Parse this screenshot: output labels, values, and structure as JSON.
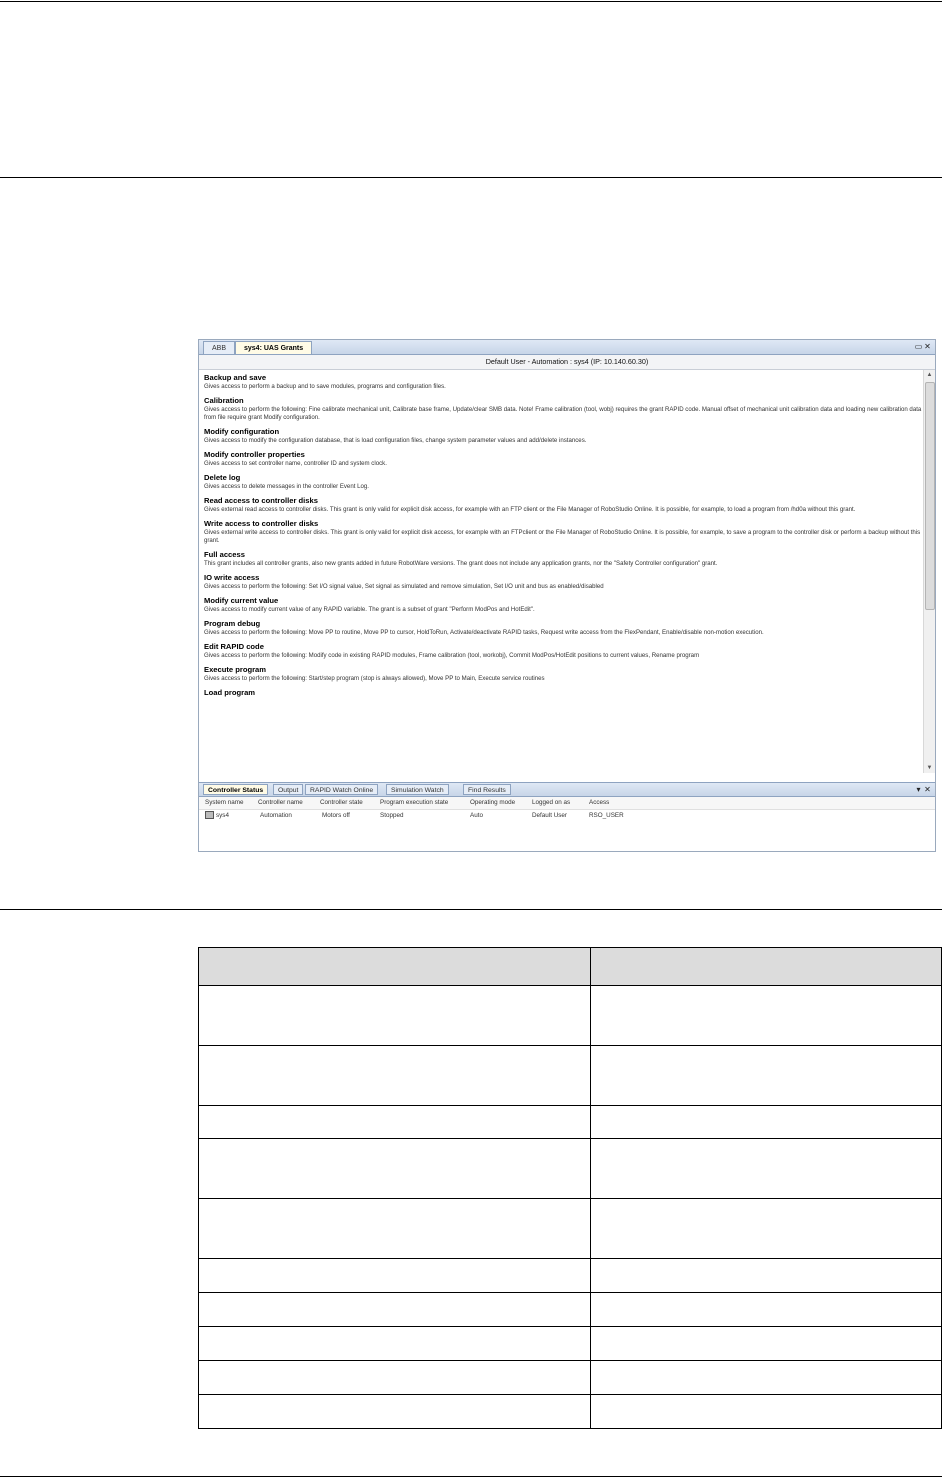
{
  "window": {
    "doc_tabs": [
      "ABB",
      "sys4: UAS Grants"
    ],
    "header": "Default User - Automation : sys4     (IP: 10.140.60.30)",
    "grants": [
      {
        "name": "Backup and save",
        "desc": "Gives access to perform a backup and to save modules, programs and configuration files."
      },
      {
        "name": "Calibration",
        "desc": "Gives access to perform the following: Fine calibrate mechanical unit, Calibrate base frame, Update/clear SMB data. Note! Frame calibration (tool, wobj) requires the grant RAPID code. Manual offset of mechanical unit calibration data and loading new calibration data from file require grant Modify configuration."
      },
      {
        "name": "Modify configuration",
        "desc": "Gives access to modify the configuration database, that is load configuration files, change system parameter values and add/delete instances."
      },
      {
        "name": "Modify controller properties",
        "desc": "Gives access to set controller name, controller ID and system clock."
      },
      {
        "name": "Delete log",
        "desc": "Gives access to delete messages in the controller Event Log."
      },
      {
        "name": "Read access to controller disks",
        "desc": "Gives external read access to controller disks. This grant is only valid for explicit disk access, for example with an FTP client or the File Manager of RoboStudio Online. It is possible, for example, to load a program from /hd0a without this grant."
      },
      {
        "name": "Write access to controller disks",
        "desc": "Gives external write access to controller disks. This grant is only valid for explicit disk access, for example with an FTPclient or the File Manager of RoboStudio Online. It is possible, for example, to save a program to the controller disk or perform a backup without this grant."
      },
      {
        "name": "Full access",
        "desc": "This grant includes all controller grants, also new grants added in future RobotWare versions. The grant does not include any application grants, nor the \"Safety Controller configuration\" grant."
      },
      {
        "name": "IO write access",
        "desc": "Gives access to perform the following: Set I/O signal value, Set signal as simulated and remove simulation, Set I/O unit and bus as enabled/disabled"
      },
      {
        "name": "Modify current value",
        "desc": "Gives access to modify current value of any RAPID variable. The grant is a subset of grant \"Perform ModPos and HotEdit\"."
      },
      {
        "name": "Program debug",
        "desc": "Gives access to perform the following: Move PP to routine, Move PP to cursor, HoldToRun, Activate/deactivate RAPID tasks, Request write access from the FlexPendant, Enable/disable non-motion execution."
      },
      {
        "name": "Edit RAPID code",
        "desc": "Gives access to perform the following: Modify code in existing RAPID modules, Frame calibration (tool, workobj), Commit ModPos/HotEdit positions to current values, Rename program"
      },
      {
        "name": "Execute program",
        "desc": "Gives access to perform the following: Start/step program (stop is always allowed), Move PP to Main, Execute service routines"
      },
      {
        "name": "Load program",
        "desc": ""
      }
    ],
    "bottom_tabs": [
      "Controller Status",
      "Output",
      "RAPID Watch Online",
      "Simulation Watch",
      "Find Results"
    ],
    "status_columns": [
      "System name",
      "Controller name",
      "Controller state",
      "Program execution state",
      "Operating mode",
      "Logged on as",
      "Access"
    ],
    "status_row": [
      "sys4",
      "Automation",
      "Motors off",
      "Stopped",
      "Auto",
      "Default User",
      "RSO_USER"
    ],
    "controls": {
      "restore": "▭",
      "close": "✕",
      "pin": "▾"
    }
  },
  "doc_table": {
    "header": [
      "",
      ""
    ],
    "rows": [
      [
        "",
        ""
      ],
      [
        "",
        ""
      ],
      [
        "",
        ""
      ],
      [
        "",
        ""
      ],
      [
        "",
        ""
      ],
      [
        "",
        ""
      ],
      [
        "",
        ""
      ],
      [
        "",
        ""
      ],
      [
        "",
        ""
      ],
      [
        "",
        ""
      ]
    ]
  }
}
